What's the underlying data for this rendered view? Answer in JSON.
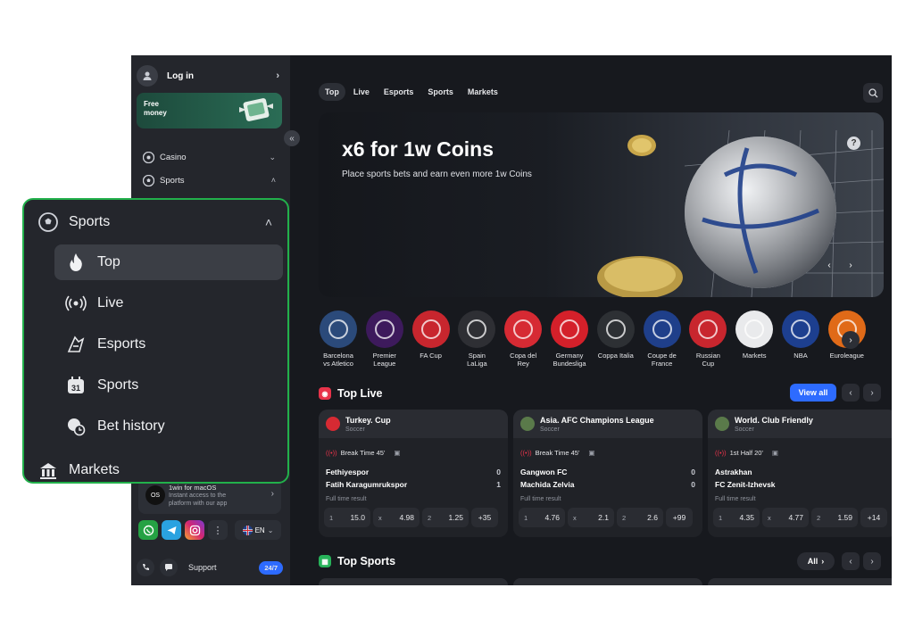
{
  "sidebar": {
    "login_label": "Log in",
    "promo": {
      "line1": "Free",
      "line2": "money"
    },
    "collapse_icon": "double-chevron-left-icon",
    "items": [
      {
        "label": "Casino",
        "icon": "casino-icon"
      },
      {
        "label": "Sports",
        "icon": "soccer-ball-icon"
      }
    ],
    "macos": {
      "title": "1win for macOS",
      "desc1": "Instant access to the",
      "desc2": "platform with our app",
      "icon_label": "OS"
    },
    "social": [
      "whatsapp-icon",
      "telegram-icon",
      "instagram-icon",
      "more-icon"
    ],
    "language": "EN",
    "support": {
      "label": "Support",
      "badge": "24/7"
    }
  },
  "header": {
    "tabs": [
      {
        "label": "Top",
        "active": true
      },
      {
        "label": "Live"
      },
      {
        "label": "Esports"
      },
      {
        "label": "Sports"
      },
      {
        "label": "Markets"
      }
    ]
  },
  "banner": {
    "title": "x6 for 1w Coins",
    "subtitle": "Place sports bets and earn even more 1w Coins",
    "help": "?"
  },
  "leagues": [
    {
      "l1": "Barcelona",
      "l2": "vs Atletico",
      "color": "#2b4a7a"
    },
    {
      "l1": "Premier",
      "l2": "League",
      "color": "#3d1a5c"
    },
    {
      "l1": "FA Cup",
      "l2": "",
      "color": "#c8262e"
    },
    {
      "l1": "Spain",
      "l2": "LaLiga",
      "color": "#2e2f34"
    },
    {
      "l1": "Copa del",
      "l2": "Rey",
      "color": "#d62a33"
    },
    {
      "l1": "Germany",
      "l2": "Bundesliga",
      "color": "#d4202a"
    },
    {
      "l1": "Coppa Italia",
      "l2": "",
      "color": "#2d3034"
    },
    {
      "l1": "Coupe de",
      "l2": "France",
      "color": "#1f3f8a"
    },
    {
      "l1": "Russian",
      "l2": "Cup",
      "color": "#c8262e"
    },
    {
      "l1": "Markets",
      "l2": "",
      "color": "#e9eaec"
    },
    {
      "l1": "NBA",
      "l2": "",
      "color": "#1d3f8f"
    },
    {
      "l1": "Euroleague",
      "l2": "",
      "color": "#e06a18"
    }
  ],
  "top_live": {
    "title": "Top Live",
    "view_all": "View all",
    "matches": [
      {
        "league": "Turkey. Cup",
        "sport": "Soccer",
        "status": "Break Time 45'",
        "team1": "Fethiyespor",
        "score1": "0",
        "team2": "Fatih Karagumrukspor",
        "score2": "1",
        "market": "Full time result",
        "o1": "15.0",
        "ox": "4.98",
        "o2": "1.25",
        "more": "+35"
      },
      {
        "league": "Asia. AFC Champions League",
        "sport": "Soccer",
        "status": "Break Time 45'",
        "team1": "Gangwon FC",
        "score1": "0",
        "team2": "Machida Zelvia",
        "score2": "0",
        "market": "Full time result",
        "o1": "4.76",
        "ox": "2.1",
        "o2": "2.6",
        "more": "+99"
      },
      {
        "league": "World. Club Friendly",
        "sport": "Soccer",
        "status": "1st Half 20'",
        "team1": "Astrakhan",
        "score1": "",
        "team2": "FC Zenit-Izhevsk",
        "score2": "",
        "market": "Full time result",
        "o1": "4.35",
        "ox": "4.77",
        "o2": "1.59",
        "more": "+14"
      }
    ],
    "k1": "1",
    "kx": "x",
    "k2": "2"
  },
  "top_sports": {
    "title": "Top Sports",
    "all": "All"
  },
  "overlay": {
    "header": "Sports",
    "items": [
      {
        "label": "Top",
        "icon": "fire-icon",
        "active": true
      },
      {
        "label": "Live",
        "icon": "live-broadcast-icon"
      },
      {
        "label": "Esports",
        "icon": "esports-icon"
      },
      {
        "label": "Sports",
        "icon": "calendar-31-icon"
      },
      {
        "label": "Bet history",
        "icon": "bet-history-icon"
      }
    ],
    "markets": "Markets"
  },
  "colors": {
    "accent": "#2d6bff",
    "highlight_border": "#22b04b",
    "live_red": "#e8334a",
    "sports_green": "#27b35a"
  }
}
